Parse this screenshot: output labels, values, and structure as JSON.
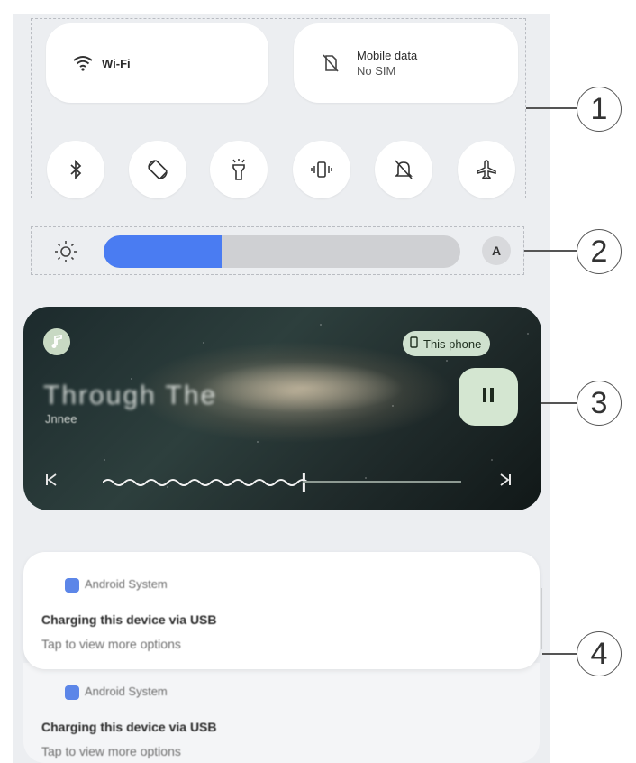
{
  "quick_settings": {
    "wifi_label": "Wi-Fi",
    "mobile_data_title": "Mobile data",
    "mobile_data_status": "No SIM",
    "toggles": [
      {
        "name": "bluetooth-icon"
      },
      {
        "name": "auto-rotate-icon"
      },
      {
        "name": "flashlight-icon"
      },
      {
        "name": "vibrate-icon"
      },
      {
        "name": "do-not-disturb-icon"
      },
      {
        "name": "airplane-mode-icon"
      }
    ]
  },
  "brightness": {
    "level_fraction": 0.33,
    "auto_label": "A",
    "fill_color": "#4a7cf2"
  },
  "media": {
    "title": "Through The",
    "artist": "Jnnee",
    "output_chip": "This phone",
    "progress_fraction": 0.56,
    "accent": "#d4e6d1"
  },
  "notifications": [
    {
      "app": "Android System",
      "title": "Charging this device via USB",
      "body": "Tap to view more options"
    },
    {
      "app": "Android System",
      "title": "Charging this device via USB",
      "body": "Tap to view more options"
    }
  ],
  "callouts": [
    "1",
    "2",
    "3",
    "4"
  ]
}
